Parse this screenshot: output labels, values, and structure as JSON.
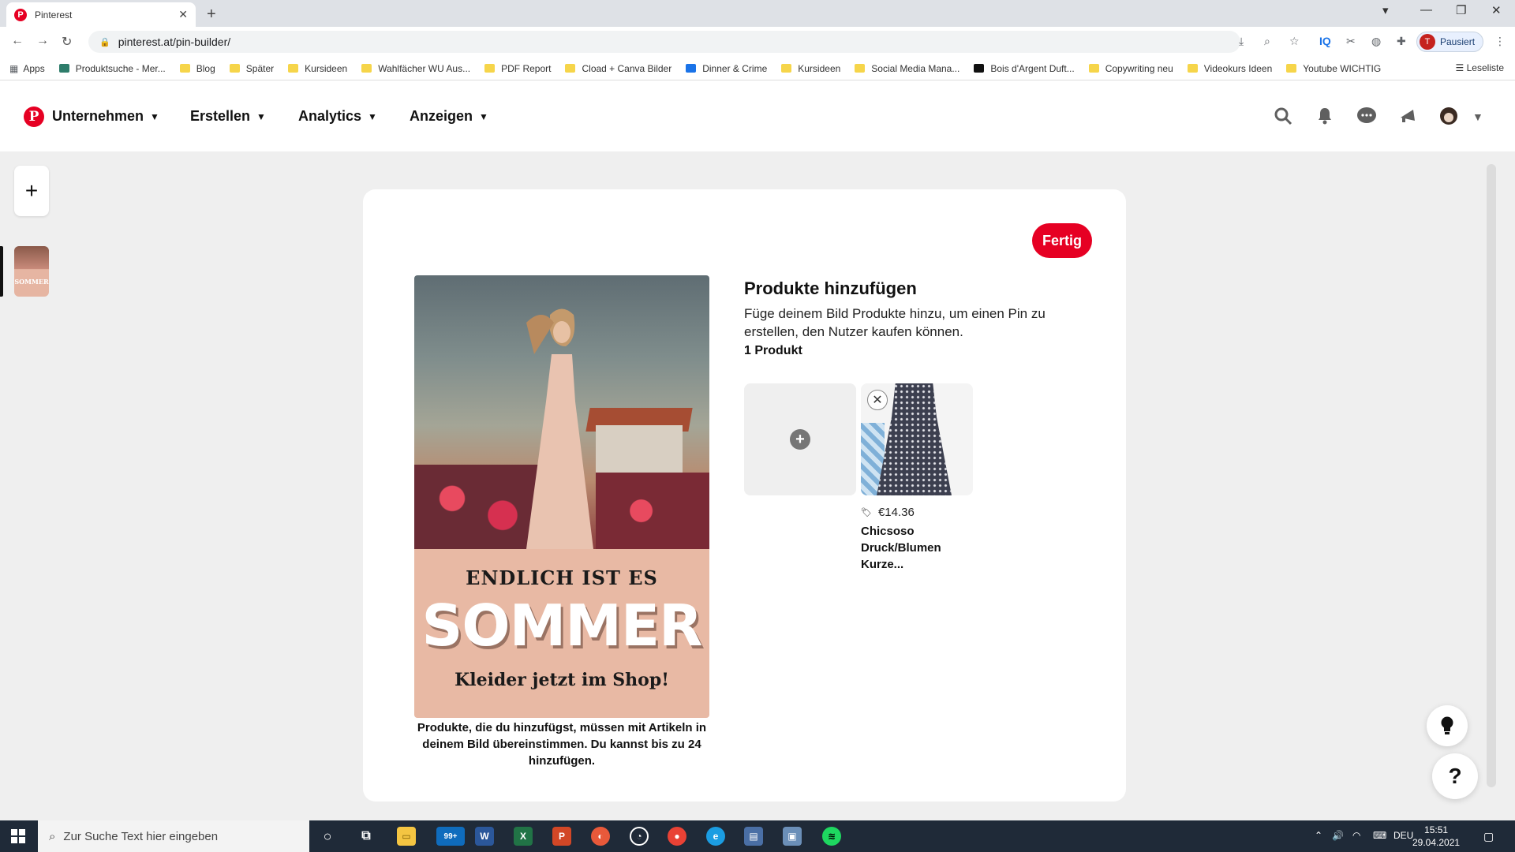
{
  "browser": {
    "tab_title": "Pinterest",
    "url": "pinterest.at/pin-builder/",
    "profile_initial": "T",
    "profile_status": "Pausiert",
    "bookmarks": [
      "Produktsuche - Mer...",
      "Blog",
      "Später",
      "Kursideen",
      "Wahlfächer WU Aus...",
      "PDF Report",
      "Cload + Canva Bilder",
      "Dinner & Crime",
      "Kursideen",
      "Social Media Mana...",
      "Bois d'Argent Duft...",
      "Copywriting neu",
      "Videokurs Ideen",
      "Youtube WICHTIG"
    ],
    "apps_label": "Apps",
    "reading_list": "Leseliste"
  },
  "header": {
    "logo": "P",
    "nav": [
      "Unternehmen",
      "Erstellen",
      "Analytics",
      "Anzeigen"
    ]
  },
  "pin": {
    "banner_line1": "ENDLICH IST ES",
    "banner_line2": "SOMMER",
    "banner_line3": "Kleider jetzt im Shop!",
    "thumb_text": "SOMMER",
    "hint": "Produkte, die du hinzufügst, müssen mit Artikeln in deinem Bild übereinstimmen. Du kannst bis zu 24 hinzufügen."
  },
  "products": {
    "done_label": "Fertig",
    "title": "Produkte hinzufügen",
    "description": "Füge deinem Bild Produkte hinzu, um einen Pin zu erstellen, den Nutzer kaufen können.",
    "count": "1 Produkt",
    "item_price": "€14.36",
    "item_name": "Chicsoso Druck/Blumen Kurze..."
  },
  "taskbar": {
    "search_placeholder": "Zur Suche Text hier eingeben",
    "mail_badge": "99+",
    "lang": "DEU",
    "time": "15:51",
    "date": "29.04.2021"
  },
  "colors": {
    "pinterest_red": "#e60023",
    "taskbar": "#1f2a38"
  }
}
